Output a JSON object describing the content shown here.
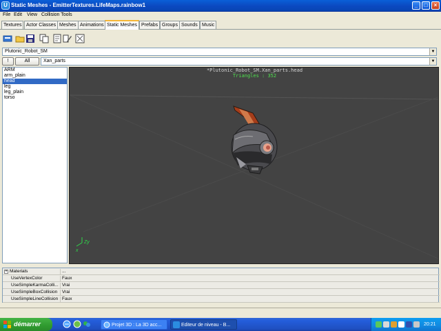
{
  "window": {
    "title": "Static Meshes - EmitterTextures.LifeMaps.rainbow1",
    "app_icon": "U",
    "controls": {
      "minimize": "_",
      "maximize": "□",
      "close": "×"
    }
  },
  "menu": [
    "File",
    "Edit",
    "View",
    "Collision Tools"
  ],
  "tabs": [
    {
      "label": "Textures",
      "active": false
    },
    {
      "label": "Actor Classes",
      "active": false
    },
    {
      "label": "Meshes",
      "active": false
    },
    {
      "label": "Animations",
      "active": false
    },
    {
      "label": "Static Meshes",
      "active": true
    },
    {
      "label": "Prefabs",
      "active": false
    },
    {
      "label": "Groups",
      "active": false
    },
    {
      "label": "Sounds",
      "active": false
    },
    {
      "label": "Music",
      "active": false
    }
  ],
  "toolbar_icons": [
    "new-package-icon",
    "open-icon",
    "save-icon",
    "duplicate-icon",
    "new-mesh-icon",
    "edit-mesh-icon"
  ],
  "package_combo": {
    "value": "Plutonic_Robot_SM",
    "arrow": "▼"
  },
  "group_filter": {
    "toggle_label": "!",
    "all_label": "All",
    "value": "Xan_parts",
    "arrow": "▼"
  },
  "mesh_list": {
    "items": [
      "ARM",
      "arm_plain",
      "head",
      "leg",
      "leg_plain",
      "torso"
    ],
    "selected": "head"
  },
  "viewport": {
    "title": "*Plutonic_Robot_SM.Xan_parts.head",
    "triangles": "Triangles : 352",
    "axis_y": "Zy",
    "axis_x": "x",
    "background_color": "#434343"
  },
  "properties": {
    "group_label": "Materials",
    "group_value": "...",
    "expander": "+",
    "rows": [
      {
        "name": "UseVertexColor",
        "value": "Faux"
      },
      {
        "name": "UseSimpleKarmaColli...",
        "value": "Vrai"
      },
      {
        "name": "UseSimpleBoxCollision",
        "value": "Vrai"
      },
      {
        "name": "UseSimpleLineCollision",
        "value": "Faux"
      }
    ]
  },
  "taskbar": {
    "start_label": "démarrer",
    "tasks": [
      {
        "label": "Projet 3D : La 3D acc...",
        "active": false
      },
      {
        "label": "Editeur de niveau - B...",
        "active": true
      }
    ],
    "clock": "20:21"
  }
}
